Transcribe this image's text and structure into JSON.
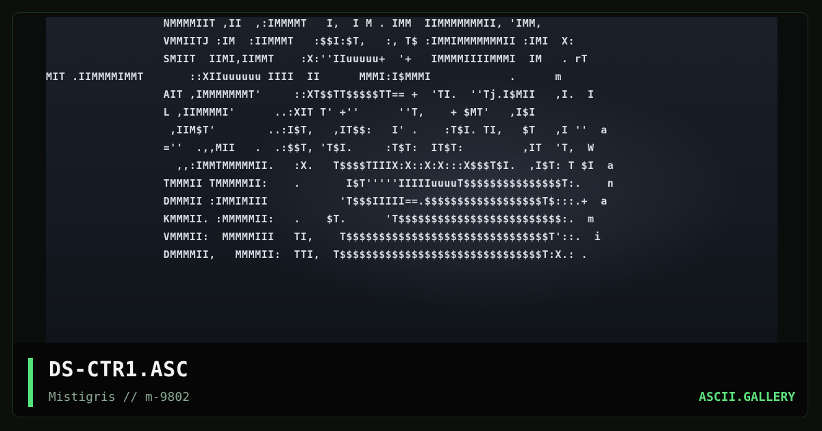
{
  "artwork": {
    "lines": [
      "                  NMMMMIIT ,II  ,:IMMMMT   I,  I M . IMM  IIMMMMMMMII, 'IMM,",
      "                  VMMIITJ :IM  :IIMMMT   :$$I:$T,   :, T$ :IMMIMMMMMMMII :IMI  X:",
      "                  SMIIT  IIMI,IIMMT    :X:''IIuuuuu+  '+   IMMMMIIIIMMMI  IM   . rT",
      "MIT .IIMMMMIMMT       ::XIIuuuuuu IIII  II      MMMI:I$MMMI            .      m",
      "                  AIT ,IMMMMMMMT'     ::XT$$TT$$$$$TT== +  'TI.  ''Tj.I$MII   ,I.  I",
      "                  L ,IIMMMMI'      ..:XIT T' +''      ''T,    + $MT'   ,I$I",
      "                   ,IIM$T'        ..:I$T,   ,IT$$:   I' .    :T$I. TI,   $T   ,I ''  a",
      "                  =''  .,,MII   .  .:$$T, 'T$I.     :T$T:  IT$T:         ,IT  'T,  W",
      "                    ,,:IMMTMMMMMII.   :X.   T$$$$TIIIX:X::X:X:::X$$$T$I.  ,I$T: T $I  a",
      "                  TMMMII TMMMMMII:    .       I$T'''''IIIIIuuuuT$$$$$$$$$$$$$$$T:.    n",
      "                  DMMMII :IMMIMIII           'T$$$IIIII==.$$$$$$$$$$$$$$$$$$T$:::.+  a",
      "                  KMMMII. :MMMMMII:   .    $T.      'T$$$$$$$$$$$$$$$$$$$$$$$$$:.  m",
      "                  VMMMII:  MMMMMIII   TI,    T$$$$$$$$$$$$$$$$$$$$$$$$$$$$$$$T'::.  i",
      "                  DMMMMII,   MMMMII:  TTI,  T$$$$$$$$$$$$$$$$$$$$$$$$$$$$$$$T:X.: ."
    ]
  },
  "caption": {
    "title": "DS-CTR1.ASC",
    "subtitle": "Mistigris // m-9802",
    "brand": "ASCII.GALLERY"
  }
}
